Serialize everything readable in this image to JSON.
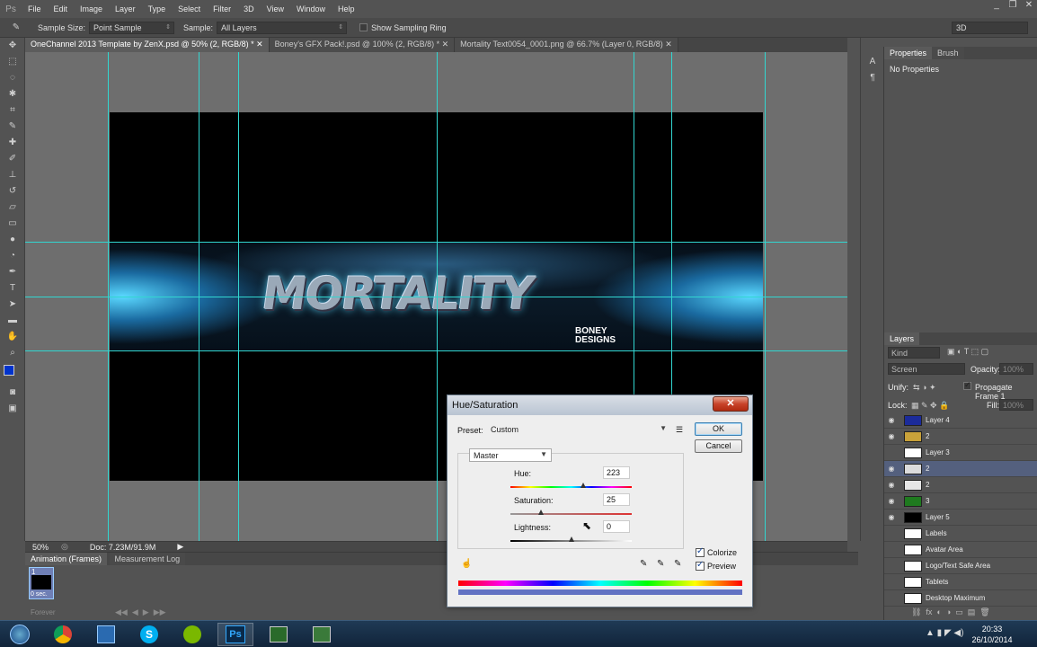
{
  "menu": {
    "items": [
      "File",
      "Edit",
      "Image",
      "Layer",
      "Type",
      "Select",
      "Filter",
      "3D",
      "View",
      "Window",
      "Help"
    ],
    "logo": "Ps"
  },
  "window_controls": [
    "_",
    "❐",
    "✕"
  ],
  "options": {
    "sample_size_label": "Sample Size:",
    "sample_size_value": "Point Sample",
    "sample_label": "Sample:",
    "sample_value": "All Layers",
    "show_ring_label": "Show Sampling Ring",
    "workspace": "3D"
  },
  "doc_tabs": [
    {
      "label": "OneChannel 2013 Template by ZenX.psd @ 50% (2, RGB/8) *",
      "close": "✕"
    },
    {
      "label": "Boney's GFX Pack!.psd @ 100% (2, RGB/8) *",
      "close": "✕"
    },
    {
      "label": "Mortality Text0054_0001.png @ 66.7% (Layer 0, RGB/8)",
      "close": "✕"
    }
  ],
  "banner": {
    "logo_text": "MORTALITY",
    "brand_line1": "BONEY",
    "brand_line2": "DESIGNS"
  },
  "status": {
    "zoom": "50%",
    "doc": "Doc: 7.23M/91.9M"
  },
  "animation": {
    "tabs": [
      "Animation (Frames)",
      "Measurement Log"
    ],
    "frame_number": "1",
    "frame_delay": "0 sec.",
    "loop": "Forever"
  },
  "properties": {
    "tabs": [
      "Properties",
      "Brush"
    ],
    "content": "No Properties"
  },
  "layers_panel": {
    "title": "Layers",
    "kind_label": "Kind",
    "blend_mode": "Screen",
    "opacity_label": "Opacity:",
    "opacity_value": "100%",
    "unify_label": "Unify:",
    "propagate_label": "Propagate Frame 1",
    "lock_label": "Lock:",
    "fill_label": "Fill:",
    "fill_value": "100%",
    "layers": [
      {
        "name": "Layer 4",
        "visible": true,
        "selected": false,
        "thumb": "#1b2b9a"
      },
      {
        "name": "2",
        "visible": true,
        "selected": false,
        "thumb": "#c9a23a"
      },
      {
        "name": "Layer 3",
        "visible": false,
        "selected": false,
        "thumb": "#ffffff"
      },
      {
        "name": "2",
        "visible": true,
        "selected": true,
        "thumb": "#dcdcdc"
      },
      {
        "name": "2",
        "visible": true,
        "selected": false,
        "thumb": "#e6e6e6"
      },
      {
        "name": "3",
        "visible": true,
        "selected": false,
        "thumb": "#1f7a1f"
      },
      {
        "name": "Layer 5",
        "visible": true,
        "selected": false,
        "thumb": "#000000"
      },
      {
        "name": "Labels",
        "visible": false,
        "selected": false,
        "thumb": "#ffffff"
      },
      {
        "name": "Avatar Area",
        "visible": false,
        "selected": false,
        "thumb": "#ffffff"
      },
      {
        "name": "Logo/Text Safe Area",
        "visible": false,
        "selected": false,
        "thumb": "#ffffff"
      },
      {
        "name": "Tablets",
        "visible": false,
        "selected": false,
        "thumb": "#ffffff"
      },
      {
        "name": "Desktop Maximum",
        "visible": false,
        "selected": false,
        "thumb": "#ffffff"
      }
    ]
  },
  "dialog": {
    "title": "Hue/Saturation",
    "close": "✕",
    "preset_label": "Preset:",
    "preset_value": "Custom",
    "channel": "Master",
    "hue_label": "Hue:",
    "hue_value": "223",
    "saturation_label": "Saturation:",
    "saturation_value": "25",
    "lightness_label": "Lightness:",
    "lightness_value": "0",
    "ok": "OK",
    "cancel": "Cancel",
    "colorize_label": "Colorize",
    "preview_label": "Preview",
    "hue_pos": 0.6,
    "sat_pos": 0.25,
    "light_pos": 0.5
  },
  "taskbar": {
    "time": "20:33",
    "date": "26/10/2014",
    "apps": [
      "start",
      "chrome",
      "excel",
      "skype",
      "spotify",
      "photoshop",
      "app7",
      "app8"
    ]
  }
}
